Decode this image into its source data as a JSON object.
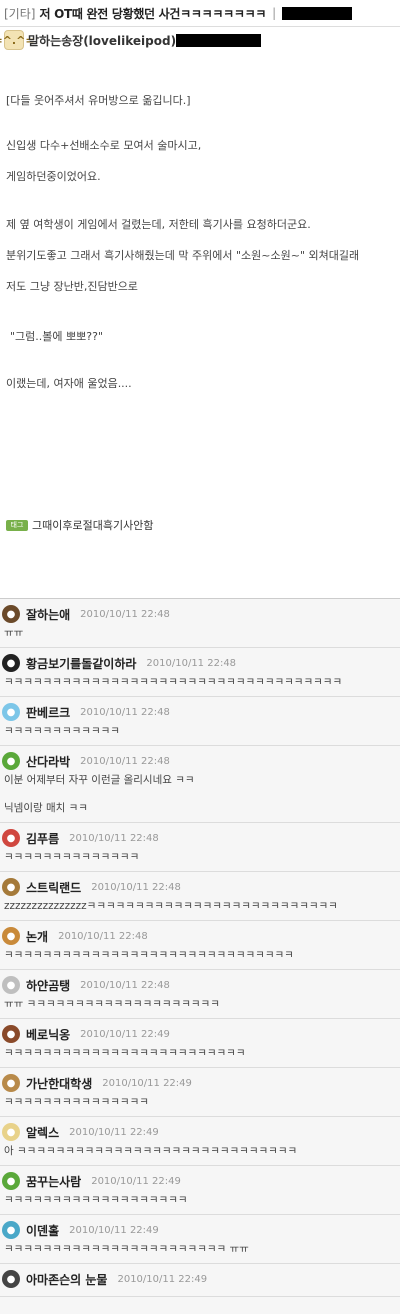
{
  "post": {
    "category": "[기타]",
    "title": "저 OT때 완전 당황했던 사건ㅋㅋㅋㅋㅋㅋㅋㅋ",
    "separator": "|",
    "author": "말하는송장(lovelikeipod)",
    "author_avatar_icon": "cat-face-icon",
    "paragraphs": [
      "[다들 웃어주셔서 유머방으로 옮깁니다.]",
      "신입생 다수+선배소수로 모여서 술마시고,",
      "게임하던중이었어요.",
      "제 옆 여학생이 게임에서 걸렸는데, 저한테 흑기사를 요청하더군요.",
      "분위기도좋고 그래서 흑기사해줬는데 막 주위에서 \"소원~소원~\" 외쳐대길래",
      "저도 그냥 장난반,진담반으로",
      "\"그럼..볼에 뽀뽀??\"",
      "이랬는데, 여자애 울었음...."
    ],
    "tag_icon_label": "태그",
    "tag": "그때이후로절대흑기사안함"
  },
  "comments": [
    {
      "name": "잘하는애",
      "time": "2010/10/11 22:48",
      "body": [
        "ㅠㅠ"
      ],
      "avatar_icon": "person-avatar-icon",
      "avatar_color": "#6b4a2a"
    },
    {
      "name": "황금보기를돌같이하라",
      "time": "2010/10/11 22:48",
      "body": [
        "ㅋㅋㅋㅋㅋㅋㅋㅋㅋㅋㅋㅋㅋㅋㅋㅋㅋㅋㅋㅋㅋㅋㅋㅋㅋㅋㅋㅋㅋㅋㅋㅋㅋㅋㅋ"
      ],
      "avatar_icon": "butterfly-icon",
      "avatar_color": "#222222"
    },
    {
      "name": "판베르크",
      "time": "2010/10/11 22:48",
      "body": [
        "ㅋㅋㅋㅋㅋㅋㅋㅋㅋㅋㅋㅋ"
      ],
      "avatar_icon": "sky-icon",
      "avatar_color": "#7cc6e8"
    },
    {
      "name": "산다라박",
      "time": "2010/10/11 22:48",
      "body": [
        "이분 어제부터 자꾸 이런글 올리시네요 ㅋㅋ",
        "닉넴이랑 매치 ㅋㅋ"
      ],
      "avatar_icon": "leaf-icon",
      "avatar_color": "#5aa83a"
    },
    {
      "name": "김푸름",
      "time": "2010/10/11 22:48",
      "body": [
        "ㅋㅋㅋㅋㅋㅋㅋㅋㅋㅋㅋㅋㅋㅋ"
      ],
      "avatar_icon": "watermelon-icon",
      "avatar_color": "#d0473f"
    },
    {
      "name": "스트릭랜드",
      "time": "2010/10/11 22:48",
      "body": [
        "zzzzzzzzzzzzzzzㅋㅋㅋㅋㅋㅋㅋㅋㅋㅋㅋㅋㅋㅋㅋㅋㅋㅋㅋㅋㅋㅋㅋㅋㅋㅋ"
      ],
      "avatar_icon": "face-icon",
      "avatar_color": "#a57a3a"
    },
    {
      "name": "논개",
      "time": "2010/10/11 22:48",
      "body": [
        "ㅋㅋㅋㅋㅋㅋㅋㅋㅋㅋㅋㅋㅋㅋㅋㅋㅋㅋㅋㅋㅋㅋㅋㅋㅋㅋㅋㅋㅋㅋ"
      ],
      "avatar_icon": "dog-icon",
      "avatar_color": "#c98a3a"
    },
    {
      "name": "하얀곰탱",
      "time": "2010/10/11 22:48",
      "body": [
        "ㅠㅠ ㅋㅋㅋㅋㅋㅋㅋㅋㅋㅋㅋㅋㅋㅋㅋㅋㅋㅋㅋㅋ"
      ],
      "avatar_icon": "bear-icon",
      "avatar_color": "#bfbfbf"
    },
    {
      "name": "베로닉옹",
      "time": "2010/10/11 22:49",
      "body": [
        "ㅋㅋㅋㅋㅋㅋㅋㅋㅋㅋㅋㅋㅋㅋㅋㅋㅋㅋㅋㅋㅋㅋㅋㅋㅋ"
      ],
      "avatar_icon": "girl-avatar-icon",
      "avatar_color": "#8a4a2a"
    },
    {
      "name": "가난한대학생",
      "time": "2010/10/11 22:49",
      "body": [
        "ㅋㅋㅋㅋㅋㅋㅋㅋㅋㅋㅋㅋㅋㅋㅋ"
      ],
      "avatar_icon": "glasses-face-icon",
      "avatar_color": "#b88a4a"
    },
    {
      "name": "알렉스",
      "time": "2010/10/11 22:49",
      "body": [
        "아 ㅋㅋㅋㅋㅋㅋㅋㅋㅋㅋㅋㅋㅋㅋㅋㅋㅋㅋㅋㅋㅋㅋㅋㅋㅋㅋㅋㅋㅋ"
      ],
      "avatar_icon": "car-icon",
      "avatar_color": "#e8d28a"
    },
    {
      "name": "꿈꾸는사람",
      "time": "2010/10/11 22:49",
      "body": [
        "ㅋㅋㅋㅋㅋㅋㅋㅋㅋㅋㅋㅋㅋㅋㅋㅋㅋㅋㅋ"
      ],
      "avatar_icon": "leaf-icon",
      "avatar_color": "#5aa83a"
    },
    {
      "name": "이덴홀",
      "time": "2010/10/11 22:49",
      "body": [
        "ㅋㅋㅋㅋㅋㅋㅋㅋㅋㅋㅋㅋㅋㅋㅋㅋㅋㅋㅋㅋㅋㅋㅋ ㅠㅠ"
      ],
      "avatar_icon": "cat-icon",
      "avatar_color": "#4aa8c8"
    },
    {
      "name": "아마존슨의 눈물",
      "time": "2010/10/11 22:49",
      "body": [],
      "avatar_icon": "person-avatar-icon",
      "avatar_color": "#444444"
    }
  ]
}
